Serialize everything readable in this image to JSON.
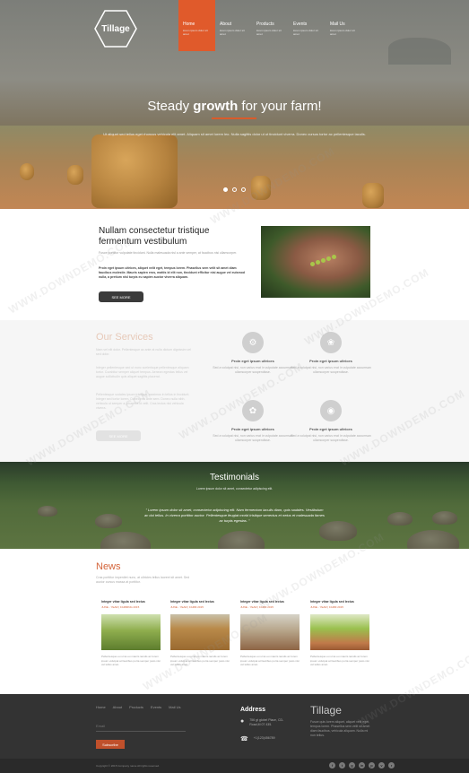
{
  "brand": {
    "logo_text": "Tillage"
  },
  "nav": [
    {
      "label": "Home",
      "sub": "lorem ipsum dolor sit amet"
    },
    {
      "label": "About",
      "sub": "lorem ipsum dolor sit amet"
    },
    {
      "label": "Products",
      "sub": "lorem ipsum dolor sit amet"
    },
    {
      "label": "Events",
      "sub": "lorem ipsum dolor sit amet"
    },
    {
      "label": "Mail Us",
      "sub": "lorem ipsum dolor sit amet"
    }
  ],
  "hero": {
    "title_pre": "Steady ",
    "title_bold": "growth",
    "title_post": " for your farm!",
    "text": "Ut aliquet sed tellus eget rhoncus vehicula elit amet. Aliquam sit amet lorem leo. Nulla sagittis dolor ut ut tincidunt viverra. Donec cursus tortor ac pellentesque iaculis."
  },
  "intro": {
    "title": "Nullam consectetur tristique fermentum vestibulum",
    "small": "Fusce porttitor vulputate tincidunt. Nulla malesuada nisl a ante semper, at faucibus nisi ullamcorper.",
    "bold": "Proin eget ipsum ultrices, aliquet velit eget, tempus lorem. Phasellus sem velit sit amet diam faucibus molestie. Mauris sapien eros, mattis id elit non, tincidunt efficitur nisi augue vel euismod nulla, a pretium nisl turpis eu sapien auctor viverra aliquam.",
    "button": "SEE MORE"
  },
  "services": {
    "title": "Our Services",
    "p1": "Nam vel elit dolor. Pellentesque ac ante at nulla dictum dignissim vel sed dolor.",
    "p2": "Integer pellentesque sed ut nunc scelerisque pellentesque aliquam tortor. Curabitur semper aliquet tempus. Aenean egestas tellus vel augue sollicitudin quis aliquet sagittis placerat.",
    "p3": "Pellentesque sodales ipsum tristique, maximus in tellus in tincidunt. Integer sed tortor lorem. Donec nec ante sem. Donec nulla nibh, vehicula ut semper a, pharetra id velit. Cras lectus nisi vehicula viverra.",
    "button": "SEE MORE",
    "items": [
      {
        "title": "Proin eget ipsum ultrices",
        "text": "Sed a volutpat nisi, non varius erat in vulputate accumsan ullamcorper suspendisse."
      },
      {
        "title": "Proin eget ipsum ultrices",
        "text": "Sed a volutpat nisi, non varius erat in vulputate accumsan ullamcorper suspendisse."
      },
      {
        "title": "Proin eget ipsum ultrices",
        "text": "Sed a volutpat nisi, non varius erat in vulputate accumsan ullamcorper suspendisse."
      },
      {
        "title": "Proin eget ipsum ultrices",
        "text": "Sed a volutpat nisi, non varius erat in vulputate accumsan ullamcorper suspendisse."
      }
    ]
  },
  "testimonials": {
    "title": "Testimonials",
    "sub": "Lorem ipsum dolor sit amet, consectetur adipiscing elit.",
    "quote": "\" Lorem ipsum dolor sit amet, consectetur adipiscing elit. Nam fermentum iaculis diam, quis sodales. Vestibulum ac dui tellus. In viverra porttitor auctor. Pellentesque feugiat morbi tristique senectus et netus et malesuada fames ac turpis egestas. \""
  },
  "news": {
    "title": "News",
    "intro": "Cras porttitor imperdiet nunc, at ultricies tellus laoreet sit amet. Sed auctor cursus massa at porttitor.",
    "cards": [
      {
        "title": "Integer vitae ligula sed lectus",
        "meta": "JUNE - YEAR | FARMING 2015",
        "text": "Pellentesque eu urna eu mauris iaculis ac lorem ipsum volutpat at faucibus porta semper justo nisi vel tellus amet."
      },
      {
        "title": "Integer vitae ligula sed lectus",
        "meta": "JUNE - YEAR | FARM 2015",
        "text": "Pellentesque eu urna eu mauris iaculis ac lorem ipsum volutpat at faucibus porta semper justo nisi vel tellus amet."
      },
      {
        "title": "Integer vitae ligula sed lectus",
        "meta": "JUNE - YEAR | FARM 2015",
        "text": "Pellentesque eu urna eu mauris iaculis ac lorem ipsum volutpat at faucibus porta semper justo nisi vel tellus amet."
      },
      {
        "title": "Integer vitae ligula sed lectus",
        "meta": "JUNE - YEAR | FARM 2015",
        "text": "Pellentesque eu urna eu mauris iaculis ac lorem ipsum volutpat at faucibus porta semper justo nisi vel tellus amet."
      }
    ]
  },
  "footer": {
    "nav": [
      "Home",
      "About",
      "Products",
      "Events",
      "Mail Us"
    ],
    "email_placeholder": "Email",
    "subscribe": "Subscribe",
    "address_title": "Address",
    "address_line": "756 gt globel Place, CD-Road,M 07 435.",
    "phone": "+1(123)456789",
    "title": "Tillage",
    "desc": "Fusce quis lorem aliquet, aliquet velit eget, tempus lorem. Phasellus sem velit sit amet diam faucibus, vehicula aliquam. Nulla mi non tellus.",
    "copyright": "Copyright © 2015 Company name All rights reserved.",
    "social": [
      "f",
      "t",
      "g",
      "in",
      "p",
      "v",
      "r"
    ]
  },
  "watermark": "WWW.DOWNDEMO.COM",
  "colors": {
    "accent": "#e05a2b",
    "dark": "#333333"
  }
}
